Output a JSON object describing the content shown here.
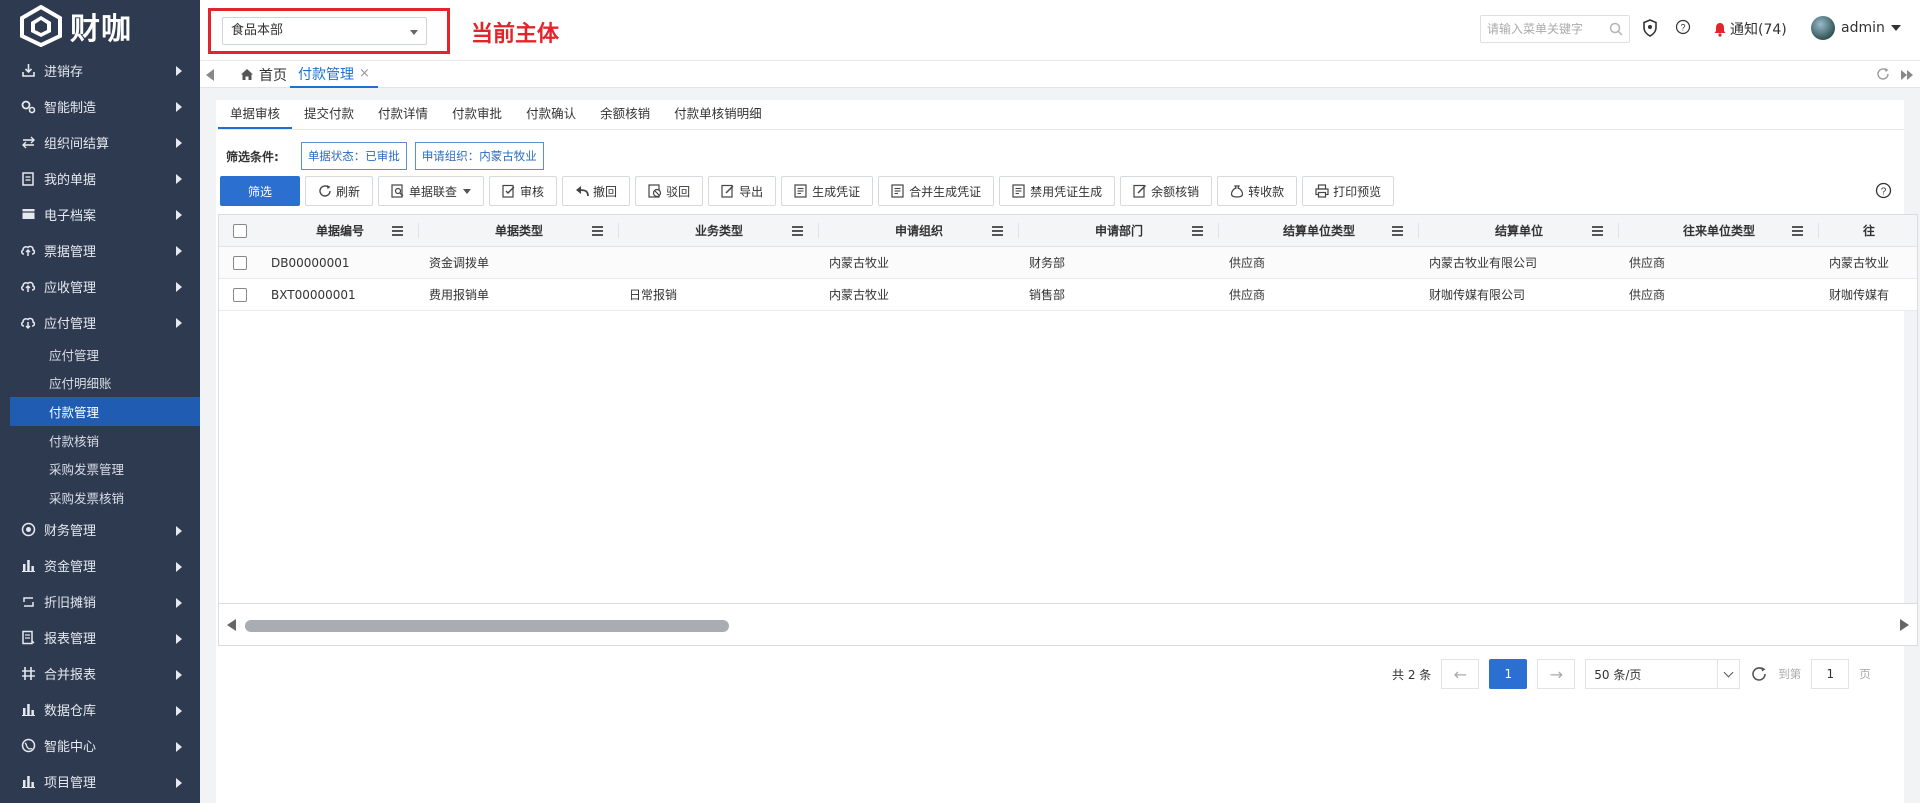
{
  "brand": {
    "name": "财咖"
  },
  "sidebar": {
    "items": [
      {
        "label": "进销存",
        "icon": "download-icon"
      },
      {
        "label": "智能制造",
        "icon": "gears-icon"
      },
      {
        "label": "组织间结算",
        "icon": "exchange-icon"
      },
      {
        "label": "我的单据",
        "icon": "clipboard-icon"
      },
      {
        "label": "电子档案",
        "icon": "archive-icon"
      },
      {
        "label": "票据管理",
        "icon": "cloud-upload-icon"
      },
      {
        "label": "应收管理",
        "icon": "cloud-upload-icon"
      },
      {
        "label": "应付管理",
        "icon": "cloud-download-icon"
      }
    ],
    "sub_items": [
      {
        "label": "应付管理"
      },
      {
        "label": "应付明细账"
      },
      {
        "label": "付款管理"
      },
      {
        "label": "付款核销"
      },
      {
        "label": "采购发票管理"
      },
      {
        "label": "采购发票核销"
      }
    ],
    "items_after": [
      {
        "label": "财务管理",
        "icon": "target-icon"
      },
      {
        "label": "资金管理",
        "icon": "bar-chart-icon"
      },
      {
        "label": "折旧摊销",
        "icon": "repeat-icon"
      },
      {
        "label": "报表管理",
        "icon": "report-icon"
      },
      {
        "label": "合并报表",
        "icon": "merge-icon"
      },
      {
        "label": "数据仓库",
        "icon": "bar-chart-icon"
      },
      {
        "label": "智能中心",
        "icon": "globe-icon"
      },
      {
        "label": "项目管理",
        "icon": "bar-chart-icon"
      }
    ]
  },
  "header": {
    "entity_value": "食品本部",
    "entity_note": "当前主体",
    "search_placeholder": "请输入菜单关键字",
    "notify_label": "通知(74)",
    "user": "admin"
  },
  "tabs": {
    "home": "首页",
    "current": "付款管理",
    "close": "×"
  },
  "subtabs": [
    "单据审核",
    "提交付款",
    "付款详情",
    "付款审批",
    "付款确认",
    "余额核销",
    "付款单核销明细"
  ],
  "filters": {
    "label": "筛选条件:",
    "chips": [
      "单据状态：已审批",
      "申请组织：内蒙古牧业"
    ]
  },
  "actions": [
    {
      "label": "筛选",
      "icon": ""
    },
    {
      "label": "刷新",
      "icon": "refresh-icon"
    },
    {
      "label": "单据联查",
      "icon": "search-doc-icon"
    },
    {
      "label": "审核",
      "icon": "check-doc-icon"
    },
    {
      "label": "撤回",
      "icon": "undo-icon"
    },
    {
      "label": "驳回",
      "icon": "reject-icon"
    },
    {
      "label": "导出",
      "icon": "export-icon"
    },
    {
      "label": "生成凭证",
      "icon": "voucher-icon"
    },
    {
      "label": "合并生成凭证",
      "icon": "voucher-icon"
    },
    {
      "label": "禁用凭证生成",
      "icon": "voucher-icon"
    },
    {
      "label": "余额核销",
      "icon": "edit-doc-icon"
    },
    {
      "label": "转收款",
      "icon": "money-bag-icon"
    },
    {
      "label": "打印预览",
      "icon": "printer-icon"
    }
  ],
  "table": {
    "columns": [
      "单据编号",
      "单据类型",
      "业务类型",
      "申请组织",
      "申请部门",
      "结算单位类型",
      "结算单位",
      "往来单位类型",
      "往"
    ],
    "rows": [
      [
        "DB00000001",
        "资金调拨单",
        "",
        "内蒙古牧业",
        "财务部",
        "供应商",
        "内蒙古牧业有限公司",
        "供应商",
        "内蒙古牧业"
      ],
      [
        "BXT00000001",
        "费用报销单",
        "日常报销",
        "内蒙古牧业",
        "销售部",
        "供应商",
        "财咖传媒有限公司",
        "供应商",
        "财咖传媒有"
      ]
    ]
  },
  "pager": {
    "total": "共 2 条",
    "prev": "←",
    "current": "1",
    "next": "→",
    "page_size": "50 条/页",
    "goto_label": "到第",
    "goto_value": "1",
    "page_suffix": "页"
  }
}
